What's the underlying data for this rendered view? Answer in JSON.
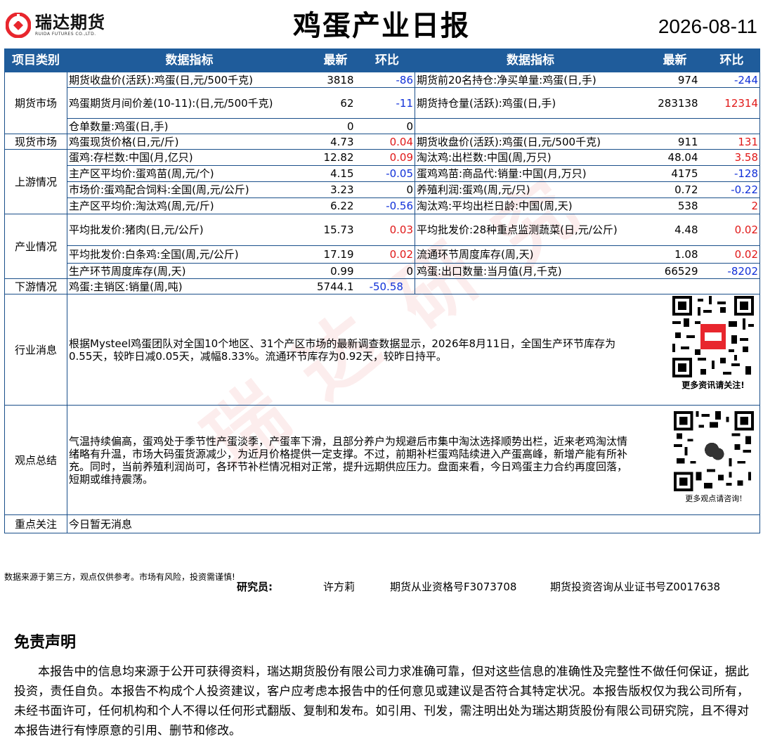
{
  "header": {
    "logo_cn": "瑞达期货",
    "logo_en": "RUIDA FUTURES CO.,LTD.",
    "title": "鸡蛋产业日报",
    "date": "2026-08-11"
  },
  "table": {
    "headers": [
      "项目类别",
      "数据指标",
      "最新",
      "环比",
      "数据指标",
      "最新",
      "环比"
    ],
    "categories": {
      "futures": "期货市场",
      "spot": "现货市场",
      "upstream": "上游情况",
      "industry": "产业情况",
      "downstream": "下游情况",
      "news": "行业消息",
      "view": "观点总结",
      "focus": "重点关注"
    },
    "rows": [
      {
        "l_label": "期货收盘价(活跃):鸡蛋(日,元/500千克)",
        "l_val": "3818",
        "l_chg": "-86",
        "r_label": "期货前20名持仓:净买单量:鸡蛋(日,手)",
        "r_val": "974",
        "r_chg": "-244"
      },
      {
        "l_label": "鸡蛋期货月间价差(10-11):(日,元/500千克)",
        "l_val": "62",
        "l_chg": "-11",
        "r_label": "期货持仓量(活跃):鸡蛋(日,手)",
        "r_val": "283138",
        "r_chg": "12314"
      },
      {
        "l_label": "仓单数量:鸡蛋(日,手)",
        "l_val": "0",
        "l_chg": "0",
        "r_label": "",
        "r_val": "",
        "r_chg": ""
      },
      {
        "l_label": "鸡蛋现货价格(日,元/斤)",
        "l_val": "4.73",
        "l_chg": "0.04",
        "r_label": "期货收盘价(活跃):鸡蛋(日,元/500千克)",
        "r_val": "911",
        "r_chg": "131"
      },
      {
        "l_label": "蛋鸡:存栏数:中国(月,亿只)",
        "l_val": "12.82",
        "l_chg": "0.09",
        "r_label": "淘汰鸡:出栏数:中国(周,万只)",
        "r_val": "48.04",
        "r_chg": "3.58"
      },
      {
        "l_label": "主产区平均价:蛋鸡苗(周,元/个)",
        "l_val": "4.15",
        "l_chg": "-0.05",
        "r_label": "蛋鸡鸡苗:商品代:销量:中国(月,万只)",
        "r_val": "4175",
        "r_chg": "-128"
      },
      {
        "l_label": "市场价:蛋鸡配合饲料:全国(周,元/公斤)",
        "l_val": "3.23",
        "l_chg": "0",
        "r_label": "养殖利润:蛋鸡(周,元/只)",
        "r_val": "0.72",
        "r_chg": "-0.22"
      },
      {
        "l_label": "主产区平均价:淘汰鸡(周,元/斤)",
        "l_val": "6.22",
        "l_chg": "-0.56",
        "r_label": "淘汰鸡:平均出栏日龄:中国(周,天)",
        "r_val": "538",
        "r_chg": "2"
      },
      {
        "l_label": "平均批发价:猪肉(日,元/公斤)",
        "l_val": "15.73",
        "l_chg": "0.03",
        "r_label": "平均批发价:28种重点监测蔬菜(日,元/公斤)",
        "r_val": "4.48",
        "r_chg": "0.02"
      },
      {
        "l_label": "平均批发价:白条鸡:全国(周,元/公斤)",
        "l_val": "17.19",
        "l_chg": "0.02",
        "r_label": "流通环节周度库存(周,天)",
        "r_val": "1.08",
        "r_chg": "0.02"
      },
      {
        "l_label": "生产环节周度库存(周,天)",
        "l_val": "0.99",
        "l_chg": "0",
        "r_label": "鸡蛋:出口数量:当月值(月,千克)",
        "r_val": "66529",
        "r_chg": "-8202"
      },
      {
        "l_label": "鸡蛋:主销区:销量(周,吨)",
        "l_val": "5744.1",
        "l_chg": "-50.58",
        "r_label": "",
        "r_val": "",
        "r_chg": ""
      }
    ],
    "news_text": "根据Mysteel鸡蛋团队对全国10个地区、31个产区市场的最新调查数据显示，2026年8月11日，全国生产环节库存为0.55天，较昨日减0.05天，减幅8.33%。流通环节库存为0.92天，较昨日持平。",
    "news_qr_caption": "更多资讯请关注!",
    "view_text": "气温持续偏高，蛋鸡处于季节性产蛋淡季，产蛋率下滑，且部分养户为规避后市集中淘汰选择顺势出栏，近来老鸡淘汰情绪略有升温，市场大码蛋货源减少，为近月价格提供一定支撑。不过，前期补栏蛋鸡陆续进入产蛋高峰，新增产能有所补充。同时，当前养殖利润尚可，各环节补栏情况相对正常，提升远期供应压力。盘面来看，今日鸡蛋主力合约再度回落，短期或维持震荡。",
    "view_qr_caption": "更多观点请咨询!",
    "focus_text": "今日暂无消息"
  },
  "footnote": "数据来源于第三方，观点仅供参考。市场有风险，投资需谨慎!",
  "author": {
    "label": "研究员:",
    "name": "许方莉",
    "cert1": "期货从业资格号F3073708",
    "cert2": "期货投资咨询从业证书号Z0017638"
  },
  "disclaimer": {
    "title": "免责声明",
    "body": "本报告中的信息均来源于公开可获得资料，瑞达期货股份有限公司力求准确可靠，但对这些信息的准确性及完整性不做任何保证，据此投资，责任自负。本报告不构成个人投资建议，客户应考虑本报告中的任何意见或建议是否符合其特定状况。本报告版权仅为我公司所有，未经书面许可，任何机构和个人不得以任何形式翻版、复制和发布。如引用、刊发，需注明出处为瑞达期货股份有限公司研究院，且不得对本报告进行有悖原意的引用、删节和修改。"
  },
  "colors": {
    "header_blue": "#1f5c9b",
    "negative": "#1030d8",
    "positive": "#e01818",
    "brand_red": "#e8262d"
  }
}
